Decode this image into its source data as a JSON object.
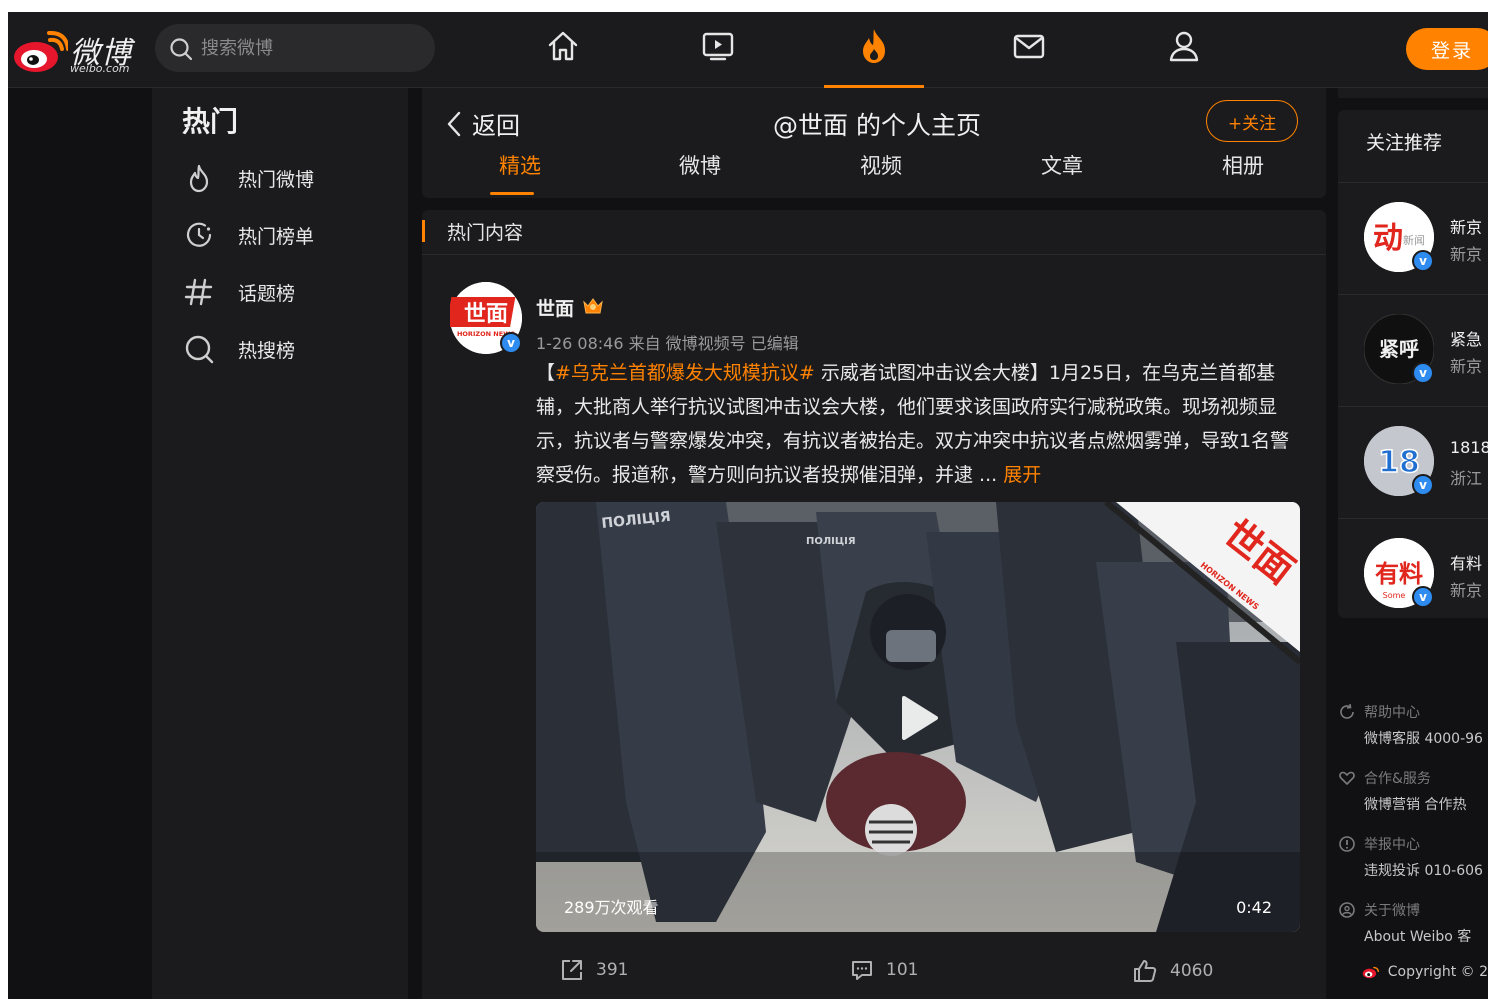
{
  "header": {
    "logo_text": "微博",
    "logo_sub": "weibo.com",
    "search_placeholder": "搜索微博",
    "nav_icons": [
      "home-icon",
      "video-icon",
      "hot-flame-icon",
      "mail-icon",
      "user-icon"
    ],
    "active_nav": "hot-flame-icon",
    "login_label": "登录"
  },
  "sidebar": {
    "title": "热门",
    "items": [
      {
        "label": "热门微博",
        "icon": "flame-icon"
      },
      {
        "label": "热门榜单",
        "icon": "clock-icon"
      },
      {
        "label": "话题榜",
        "icon": "hashtag-icon"
      },
      {
        "label": "热搜榜",
        "icon": "search-ring-icon"
      }
    ]
  },
  "profile_header": {
    "back_label": "返回",
    "title": "@世面 的个人主页",
    "follow_label": "+关注",
    "tabs": [
      "精选",
      "微博",
      "视频",
      "文章",
      "相册"
    ],
    "active_tab": "精选"
  },
  "section": {
    "title": "热门内容"
  },
  "post": {
    "avatar_text": "世面",
    "avatar_sub": "HORIZON NEWS",
    "author": "世面",
    "meta": "1-26 08:46  来自 微博视频号 已编辑",
    "text_prefix": "【",
    "hashtag": "#乌克兰首都爆发大规模抗议#",
    "text_body": " 示威者试图冲击议会大楼】1月25日，在乌克兰首都基辅，大批商人举行抗议试图冲击议会大楼，他们要求该国政府实行减税政策。现场视频显示，抗议者与警察爆发冲突，有抗议者被抬走。双方冲突中抗议者点燃烟雾弹，导致1名警察受伤。报道称，警方则向抗议者投掷催泪弹，并逮 ...",
    "expand_label": "展开",
    "video": {
      "views": "289万次观看",
      "duration": "0:42",
      "watermark": "世面",
      "watermark_sub": "HORIZON NEWS",
      "police_text": "ПОЛІЦІЯ"
    },
    "actions": {
      "repost_count": "391",
      "comment_count": "101",
      "like_count": "4060"
    }
  },
  "recommend": {
    "title": "关注推荐",
    "items": [
      {
        "name": "新京",
        "desc": "新京",
        "avatar_text": "动",
        "avatar_sub": "新闻",
        "avatar_bg": "#ffffff",
        "avatar_fg": "#e0261d"
      },
      {
        "name": "紧急",
        "desc": "新京",
        "avatar_text": "紧呼",
        "avatar_sub": "",
        "avatar_bg": "#101010",
        "avatar_fg": "#f0f0f0"
      },
      {
        "name": "1818",
        "desc": "浙江",
        "avatar_text": "18",
        "avatar_sub": "",
        "avatar_bg": "#bfc3c9",
        "avatar_fg": "#1f6fd1"
      },
      {
        "name": "有料",
        "desc": "新京",
        "avatar_text": "有料",
        "avatar_sub": "Some",
        "avatar_bg": "#ffffff",
        "avatar_fg": "#e0261d"
      }
    ]
  },
  "footer": [
    {
      "heading": "帮助中心",
      "line": "微博客服 4000-96",
      "icon": "help-icon"
    },
    {
      "heading": "合作&服务",
      "line": "微博营销    合作热",
      "icon": "heart-hand-icon"
    },
    {
      "heading": "举报中心",
      "line": "违规投诉 010-606",
      "icon": "alert-icon"
    },
    {
      "heading": "关于微博",
      "line": "About Weibo    客",
      "icon": "about-icon"
    }
  ],
  "copyright": "Copyright © 2",
  "colors": {
    "accent": "#ff8200",
    "bg": "#111113",
    "panel": "#1b1b1d",
    "verified": "#2e8cf0"
  }
}
